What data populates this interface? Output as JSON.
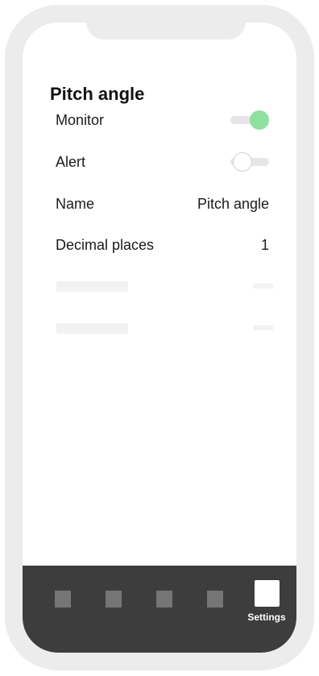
{
  "screen": {
    "title": "Pitch angle"
  },
  "settings": [
    {
      "label": "Monitor",
      "type": "toggle",
      "state": "on"
    },
    {
      "label": "Alert",
      "type": "toggle",
      "state": "off"
    },
    {
      "label": "Name",
      "type": "value",
      "value": "Pitch angle"
    },
    {
      "label": "Decimal places",
      "type": "value",
      "value": "1"
    }
  ],
  "tabbar": {
    "items": [
      {
        "icon": "tab-placeholder-icon"
      },
      {
        "icon": "tab-placeholder-icon"
      },
      {
        "icon": "tab-placeholder-icon"
      },
      {
        "icon": "tab-placeholder-icon"
      },
      {
        "icon": "settings-icon",
        "label": "Settings",
        "active": true
      }
    ]
  },
  "colors": {
    "toggle_on": "#8fdfa0",
    "toggle_track": "#e6e6e6",
    "tabbar_bg": "#3d3d3d",
    "frame": "#ececec"
  }
}
